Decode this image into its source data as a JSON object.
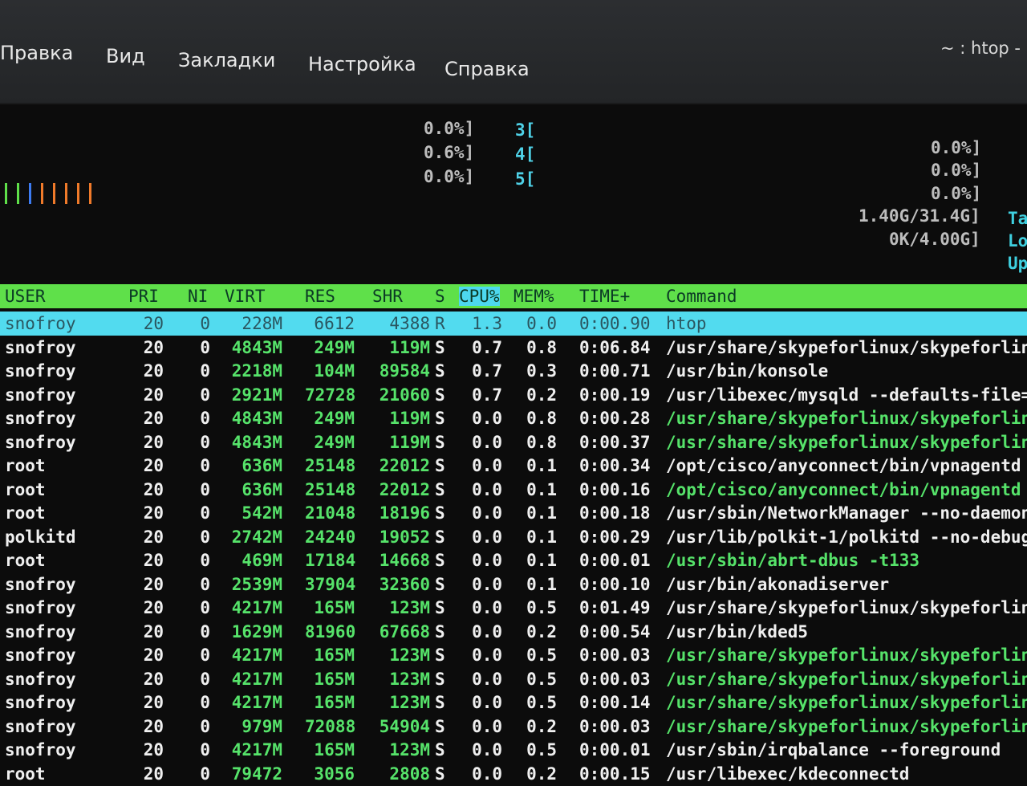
{
  "menu": {
    "items": [
      "Правка",
      "Вид",
      "Закладки",
      "Настройка",
      "Справка"
    ],
    "window_title": "~ : htop -"
  },
  "meters": {
    "left": [
      "0.0%]",
      "0.6%]",
      "0.0%]"
    ],
    "core_nums": [
      "3[",
      "4[",
      "5["
    ],
    "right": [
      "0.0%]",
      "0.0%]",
      "0.0%]"
    ],
    "mem": "1.40G/31.4G]",
    "swap": "0K/4.00G]",
    "side_labels": [
      "Ta",
      "Lo",
      "Up"
    ]
  },
  "colors": {
    "header_green": "#5fe04a",
    "selected_cyan": "#52dbef",
    "value_green": "#56e36a",
    "bar_colors": [
      "#5fe04a",
      "#5fe04a",
      "#3d7cf2",
      "#f07a2a",
      "#f07a2a",
      "#f07a2a",
      "#f07a2a",
      "#f07a2a"
    ]
  },
  "table": {
    "columns": [
      "USER",
      "PRI",
      "NI",
      "VIRT",
      "RES",
      "SHR",
      "S",
      "CPU%",
      "MEM%",
      "TIME+",
      "Command"
    ],
    "rows": [
      {
        "user": "snofroy",
        "pri": "20",
        "ni": "0",
        "virt": "228M",
        "res": "6612",
        "shr": "4388",
        "s": "R",
        "cpu": "1.3",
        "mem": "0.0",
        "time": "0:00.90",
        "cmd": "htop",
        "selected": true
      },
      {
        "user": "snofroy",
        "pri": "20",
        "ni": "0",
        "virt": "4843M",
        "res": "249M",
        "shr": "119M",
        "s": "S",
        "cpu": "0.7",
        "mem": "0.8",
        "time": "0:06.84",
        "cmd": "/usr/share/skypeforlinux/skypeforlin"
      },
      {
        "user": "snofroy",
        "pri": "20",
        "ni": "0",
        "virt": "2218M",
        "res": "104M",
        "shr": "89584",
        "s": "S",
        "cpu": "0.7",
        "mem": "0.3",
        "time": "0:00.71",
        "cmd": "/usr/bin/konsole"
      },
      {
        "user": "snofroy",
        "pri": "20",
        "ni": "0",
        "virt": "2921M",
        "res": "72728",
        "shr": "21060",
        "s": "S",
        "cpu": "0.7",
        "mem": "0.2",
        "time": "0:00.19",
        "cmd": "/usr/libexec/mysqld --defaults-file="
      },
      {
        "user": "snofroy",
        "pri": "20",
        "ni": "0",
        "virt": "4843M",
        "res": "249M",
        "shr": "119M",
        "s": "S",
        "cpu": "0.0",
        "mem": "0.8",
        "time": "0:00.28",
        "cmd": "/usr/share/skypeforlinux/skypeforlin",
        "thread": true
      },
      {
        "user": "snofroy",
        "pri": "20",
        "ni": "0",
        "virt": "4843M",
        "res": "249M",
        "shr": "119M",
        "s": "S",
        "cpu": "0.0",
        "mem": "0.8",
        "time": "0:00.37",
        "cmd": "/usr/share/skypeforlinux/skypeforlin",
        "thread": true
      },
      {
        "user": "root",
        "pri": "20",
        "ni": "0",
        "virt": "636M",
        "res": "25148",
        "shr": "22012",
        "s": "S",
        "cpu": "0.0",
        "mem": "0.1",
        "time": "0:00.34",
        "cmd": "/opt/cisco/anyconnect/bin/vpnagentd"
      },
      {
        "user": "root",
        "pri": "20",
        "ni": "0",
        "virt": "636M",
        "res": "25148",
        "shr": "22012",
        "s": "S",
        "cpu": "0.0",
        "mem": "0.1",
        "time": "0:00.16",
        "cmd": "/opt/cisco/anyconnect/bin/vpnagentd",
        "thread": true
      },
      {
        "user": "root",
        "pri": "20",
        "ni": "0",
        "virt": "542M",
        "res": "21048",
        "shr": "18196",
        "s": "S",
        "cpu": "0.0",
        "mem": "0.1",
        "time": "0:00.18",
        "cmd": "/usr/sbin/NetworkManager --no-daemon"
      },
      {
        "user": "polkitd",
        "pri": "20",
        "ni": "0",
        "virt": "2742M",
        "res": "24240",
        "shr": "19052",
        "s": "S",
        "cpu": "0.0",
        "mem": "0.1",
        "time": "0:00.29",
        "cmd": "/usr/lib/polkit-1/polkitd --no-debug"
      },
      {
        "user": "root",
        "pri": "20",
        "ni": "0",
        "virt": "469M",
        "res": "17184",
        "shr": "14668",
        "s": "S",
        "cpu": "0.0",
        "mem": "0.1",
        "time": "0:00.01",
        "cmd": "/usr/sbin/abrt-dbus -t133",
        "thread": true
      },
      {
        "user": "snofroy",
        "pri": "20",
        "ni": "0",
        "virt": "2539M",
        "res": "37904",
        "shr": "32360",
        "s": "S",
        "cpu": "0.0",
        "mem": "0.1",
        "time": "0:00.10",
        "cmd": "/usr/bin/akonadiserver"
      },
      {
        "user": "snofroy",
        "pri": "20",
        "ni": "0",
        "virt": "4217M",
        "res": "165M",
        "shr": "123M",
        "s": "S",
        "cpu": "0.0",
        "mem": "0.5",
        "time": "0:01.49",
        "cmd": "/usr/share/skypeforlinux/skypeforlinu"
      },
      {
        "user": "snofroy",
        "pri": "20",
        "ni": "0",
        "virt": "1629M",
        "res": "81960",
        "shr": "67668",
        "s": "S",
        "cpu": "0.0",
        "mem": "0.2",
        "time": "0:00.54",
        "cmd": "/usr/bin/kded5"
      },
      {
        "user": "snofroy",
        "pri": "20",
        "ni": "0",
        "virt": "4217M",
        "res": "165M",
        "shr": "123M",
        "s": "S",
        "cpu": "0.0",
        "mem": "0.5",
        "time": "0:00.03",
        "cmd": "/usr/share/skypeforlinux/skypeforlinu",
        "thread": true
      },
      {
        "user": "snofroy",
        "pri": "20",
        "ni": "0",
        "virt": "4217M",
        "res": "165M",
        "shr": "123M",
        "s": "S",
        "cpu": "0.0",
        "mem": "0.5",
        "time": "0:00.03",
        "cmd": "/usr/share/skypeforlinux/skypeforlinu",
        "thread": true
      },
      {
        "user": "snofroy",
        "pri": "20",
        "ni": "0",
        "virt": "4217M",
        "res": "165M",
        "shr": "123M",
        "s": "S",
        "cpu": "0.0",
        "mem": "0.5",
        "time": "0:00.14",
        "cmd": "/usr/share/skypeforlinux/skypeforlinu",
        "thread": true
      },
      {
        "user": "snofroy",
        "pri": "20",
        "ni": "0",
        "virt": "979M",
        "res": "72088",
        "shr": "54904",
        "s": "S",
        "cpu": "0.0",
        "mem": "0.2",
        "time": "0:00.03",
        "cmd": "/usr/share/skypeforlinux/skypeforlinu",
        "thread": true
      },
      {
        "user": "snofroy",
        "pri": "20",
        "ni": "0",
        "virt": "4217M",
        "res": "165M",
        "shr": "123M",
        "s": "S",
        "cpu": "0.0",
        "mem": "0.5",
        "time": "0:00.01",
        "cmd": "/usr/sbin/irqbalance --foreground"
      },
      {
        "user": "root",
        "pri": "20",
        "ni": "0",
        "virt": "79472",
        "res": "3056",
        "shr": "2808",
        "s": "S",
        "cpu": "0.0",
        "mem": "0.2",
        "time": "0:00.15",
        "cmd": "/usr/libexec/kdeconnectd"
      }
    ]
  }
}
